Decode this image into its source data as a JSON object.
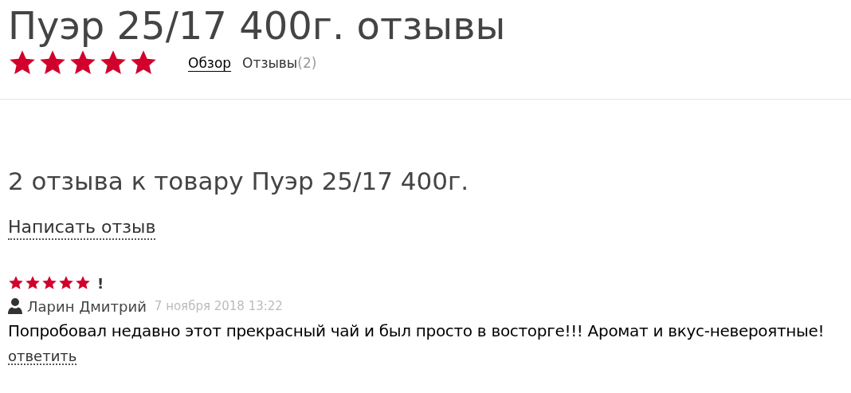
{
  "product": {
    "title": "Пуэр 25/17 400г. отзывы",
    "stars": 5
  },
  "tabs": [
    {
      "label": "Обзор",
      "selected": false
    },
    {
      "label": "Отзывы",
      "count": "(2)",
      "selected": true
    }
  ],
  "reviews_heading": "2 отзыва к товару Пуэр 25/17 400г.",
  "write_review": "Написать отзыв",
  "reviews": [
    {
      "stars": 5,
      "title": "!",
      "author": "Ларин Дмитрий",
      "date": "7 ноября 2018 13:22",
      "text": "Попробовал недавно этот прекрасный чай и был просто в восторге!!! Аромат и вкус-невероятные!",
      "reply": "ответить"
    }
  ]
}
